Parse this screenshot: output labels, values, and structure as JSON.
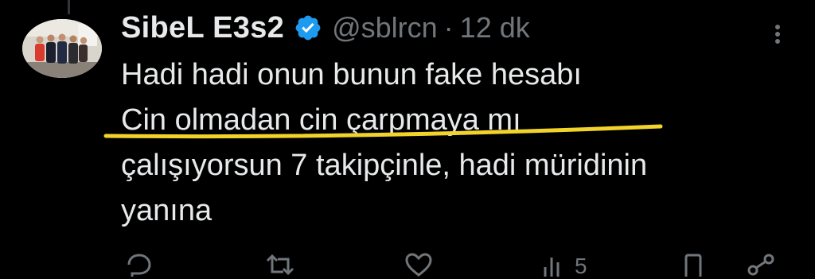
{
  "user": {
    "display_name": "SibeL E3s2",
    "handle": "@sblrcn",
    "separator": "·",
    "timestamp": "12 dk",
    "verified": true
  },
  "tweet": {
    "lines": [
      "Hadi hadi onun bunun fake hesabı",
      "Cin olmadan cin çarpmaya mı",
      "çalışıyorsun 7 takipçinle, hadi müridinin",
      "yanına"
    ]
  },
  "actions": {
    "reply_icon": "reply-icon",
    "retweet_icon": "retweet-icon",
    "like_icon": "heart-icon",
    "views_icon": "views-icon",
    "views_count": "5",
    "bookmark_icon": "bookmark-icon",
    "share_icon": "share-icon"
  },
  "colors": {
    "background": "#000000",
    "text": "#e7e9ea",
    "muted": "#71767b",
    "verified": "#1d9bf0",
    "highlight": "#f2d32b"
  }
}
